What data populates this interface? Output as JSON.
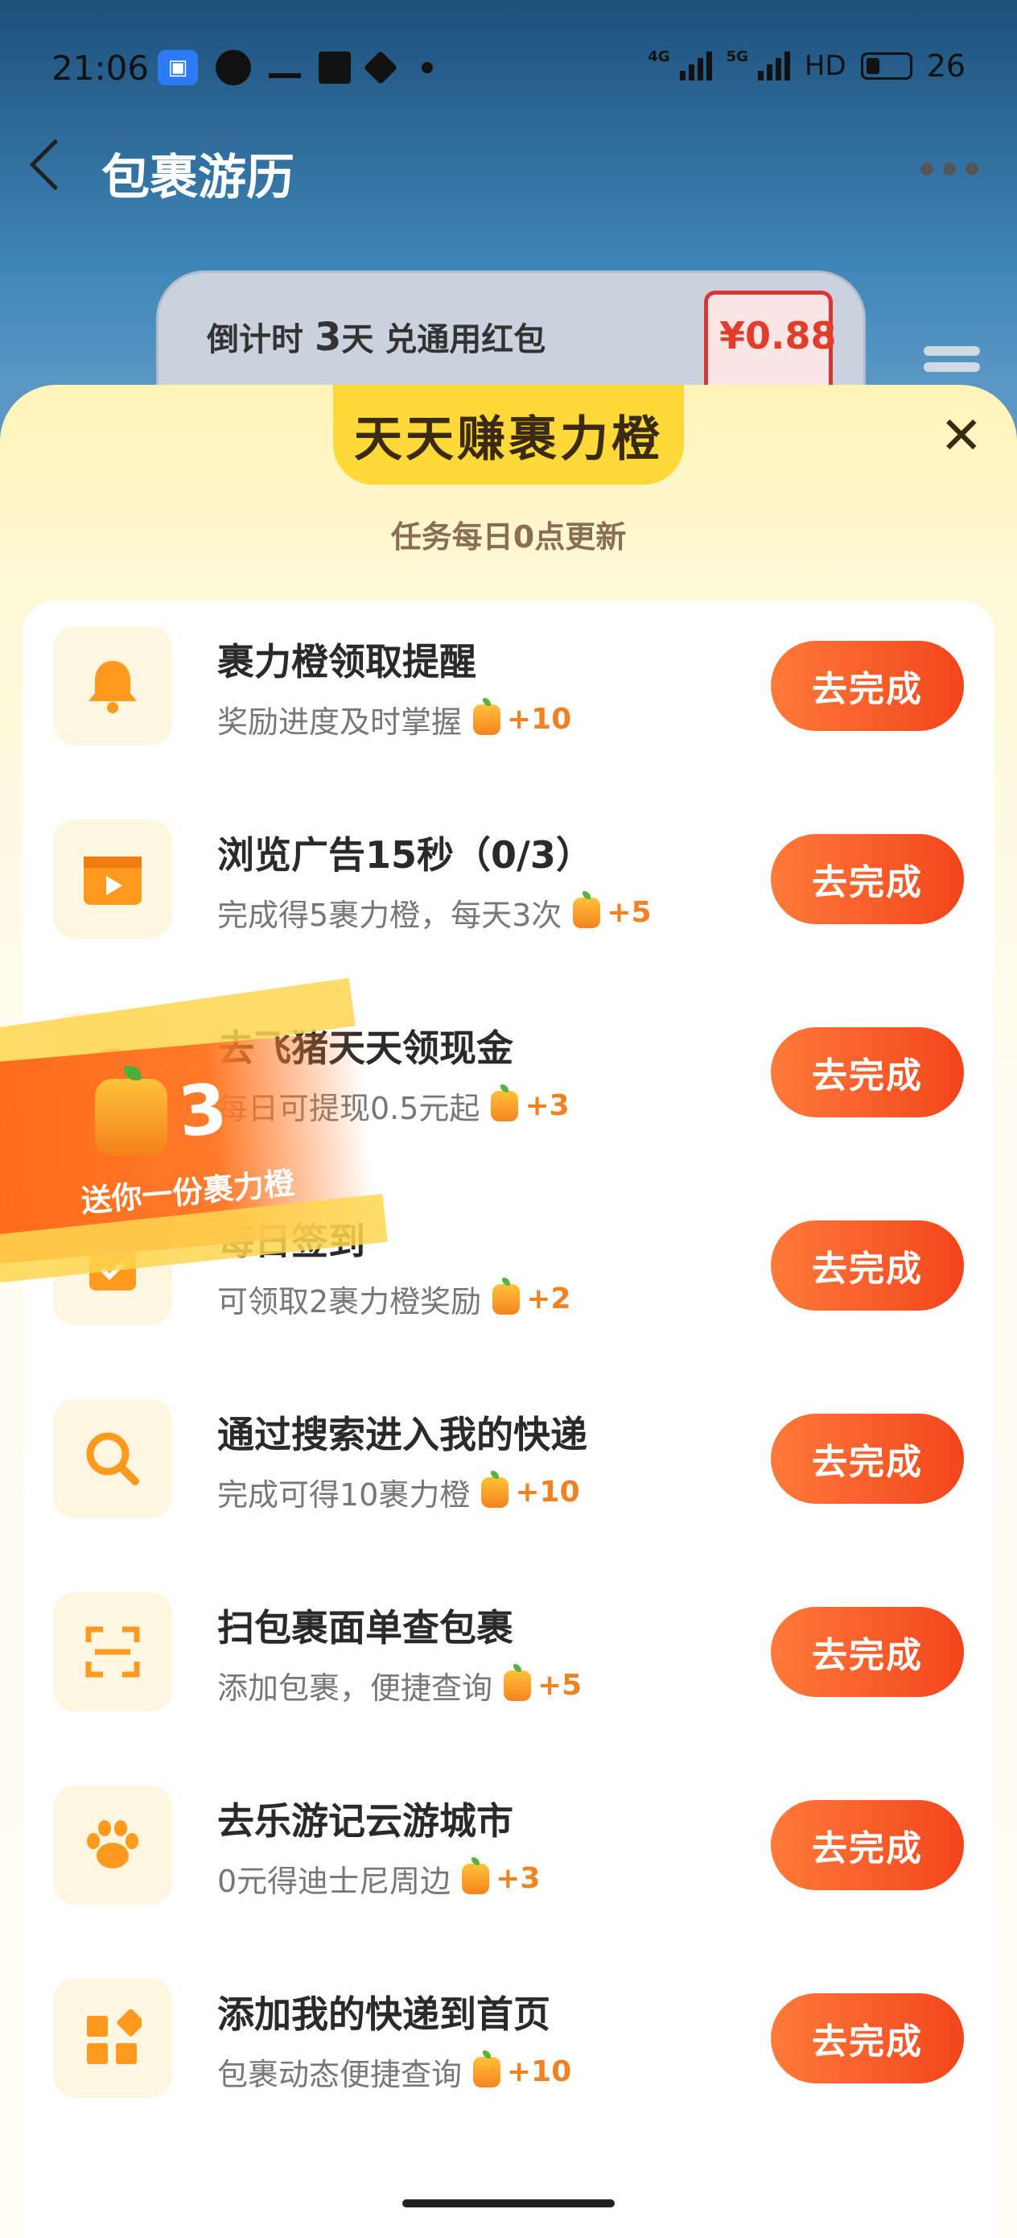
{
  "status_bar": {
    "time": "21:06",
    "net_a": "4G",
    "net_b": "5G",
    "hd": "HD",
    "battery": "26"
  },
  "nav": {
    "title": "包裹游历"
  },
  "countdown": {
    "prefix": "倒计时 ",
    "days": "3",
    "suffix": "天 兑通用红包",
    "amount": "¥0.88"
  },
  "sheet": {
    "title": "天天赚裹力橙",
    "subtitle": "任务每日0点更新",
    "close": "✕"
  },
  "tasks": [
    {
      "title": "裹力橙领取提醒",
      "desc": "奖励进度及时掌握",
      "reward": "+10",
      "button": "去完成",
      "icon": "bell-icon"
    },
    {
      "title": "浏览广告15秒（0/3）",
      "desc": "完成得5裹力橙，每天3次",
      "reward": "+5",
      "button": "去完成",
      "icon": "video-icon"
    },
    {
      "title": "去飞猪天天领现金",
      "desc": "每日可提现0.5元起",
      "reward": "+3",
      "button": "去完成",
      "icon": "cash-icon"
    },
    {
      "title": "每日签到",
      "desc": "可领取2裹力橙奖励",
      "reward": "+2",
      "button": "去完成",
      "icon": "calendar-check-icon"
    },
    {
      "title": "通过搜索进入我的快递",
      "desc": "完成可得10裹力橙",
      "reward": "+10",
      "button": "去完成",
      "icon": "search-icon"
    },
    {
      "title": "扫包裹面单查包裹",
      "desc": "添加包裹，便捷查询",
      "reward": "+5",
      "button": "去完成",
      "icon": "scan-icon"
    },
    {
      "title": "去乐游记云游城市",
      "desc": "0元得迪士尼周边",
      "reward": "+3",
      "button": "去完成",
      "icon": "paw-icon"
    },
    {
      "title": "添加我的快递到首页",
      "desc": "包裹动态便捷查询",
      "reward": "+10",
      "button": "去完成",
      "icon": "widgets-icon"
    }
  ],
  "banner": {
    "count": "3",
    "text": "送你一份裹力橙"
  },
  "colors": {
    "accent": "#f2451c",
    "orange": "#f08222",
    "yellow": "#ffd83a"
  }
}
